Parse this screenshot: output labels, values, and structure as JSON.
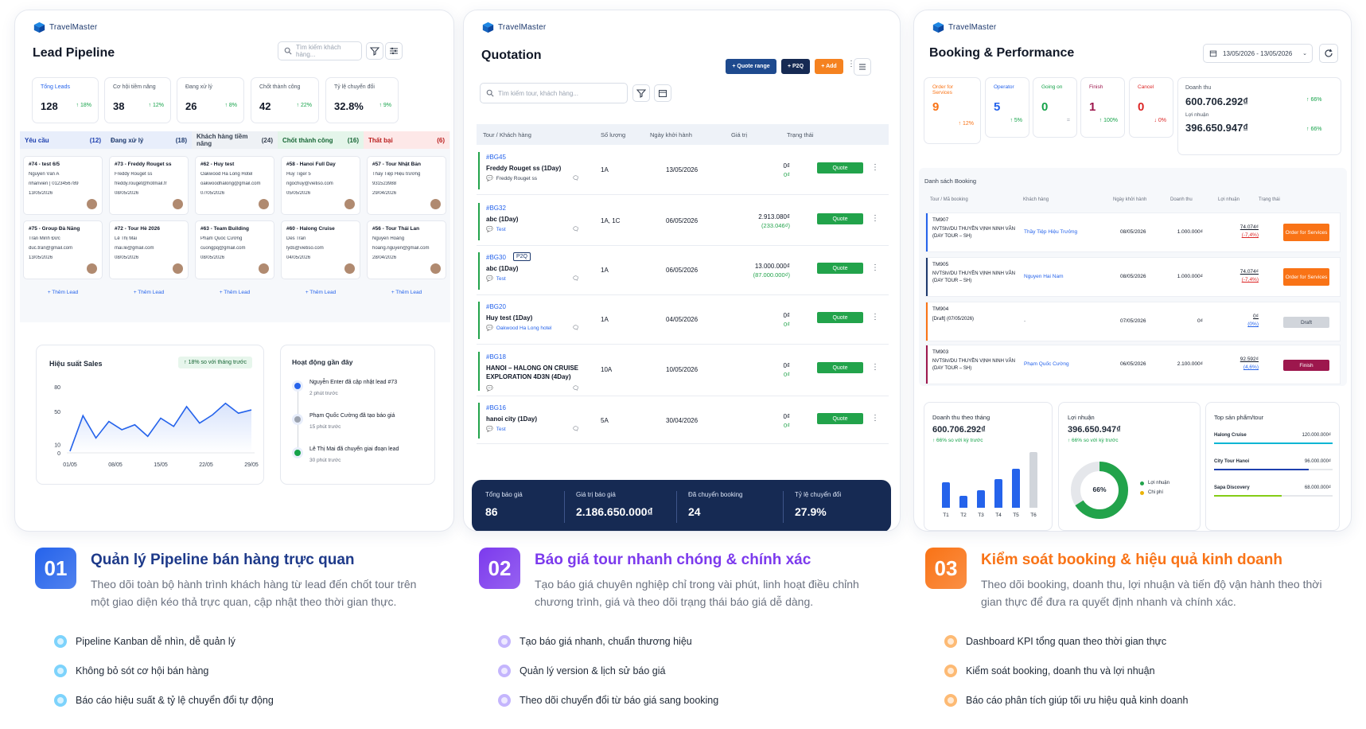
{
  "brand": "TravelMaster",
  "panel1": {
    "title": "Lead Pipeline",
    "search_placeholder": "Tìm kiếm khách hàng...",
    "kpis": [
      {
        "label": "Tổng Leads",
        "value": "128",
        "delta": "↑ 18%",
        "color": "#2563eb"
      },
      {
        "label": "Cơ hội tiềm năng",
        "value": "38",
        "delta": "↑ 12%",
        "color": "#4b5563"
      },
      {
        "label": "Đang xử lý",
        "value": "26",
        "delta": "↑ 8%",
        "color": "#4b5563"
      },
      {
        "label": "Chốt thành công",
        "value": "42",
        "delta": "↑ 22%",
        "color": "#4b5563"
      },
      {
        "label": "Tỷ lệ chuyển đổi",
        "value": "32.8%",
        "delta": "↑ 9%",
        "color": "#4b5563"
      }
    ],
    "columns": [
      {
        "name": "Yêu cầu",
        "count": "(12)",
        "bg": "#e8eefb",
        "color": "#1e40af",
        "cards": [
          {
            "title": "#74 - test 6/5",
            "l1": "Nguyễn Văn A",
            "l2": "nhanvien | 0123456789",
            "date": "13/05/2026"
          },
          {
            "title": "#75 - Group Đà Nẵng",
            "l1": "Trần Minh Đức",
            "l2": "duc.tran@gmail.com",
            "date": "13/05/2026"
          }
        ]
      },
      {
        "name": "Đang xử lý",
        "count": "(18)",
        "bg": "#e8eefb",
        "color": "#1e3a6e",
        "cards": [
          {
            "title": "#73 - Freddy Rouget ss",
            "l1": "Freddy Rouget ss",
            "l2": "freddy.rouget@hotmail.fr",
            "date": "08/05/2026"
          },
          {
            "title": "#72 - Tour Hè 2026",
            "l1": "Lê Thị Mai",
            "l2": "mai.le@gmail.com",
            "date": "08/05/2026"
          }
        ]
      },
      {
        "name": "Khách hàng tiềm năng",
        "count": "(24)",
        "bg": "#eef1f5",
        "color": "#374151",
        "cards": [
          {
            "title": "#62 - Huy test",
            "l1": "Oakwood Ha Long Hotel",
            "l2": "oakwoodhalong@gmail.com",
            "date": "07/05/2026"
          },
          {
            "title": "#63 - Team Building",
            "l1": "Phạm Quốc Cường",
            "l2": "cuongpq@gmail.com",
            "date": "08/05/2026"
          }
        ]
      },
      {
        "name": "Chốt thành công",
        "count": "(16)",
        "bg": "#e4f5ea",
        "color": "#166534",
        "cards": [
          {
            "title": "#58 - Hanoi Full Day",
            "l1": "Huy Tiger 5",
            "l2": "ngochuy@vietiso.com",
            "date": "05/05/2026"
          },
          {
            "title": "#60 - Halong Cruise",
            "l1": "Des Tran",
            "l2": "lyds@vietiso.com",
            "date": "04/05/2026"
          }
        ]
      },
      {
        "name": "Thất bại",
        "count": "(6)",
        "bg": "#fde8e8",
        "color": "#b91c1c",
        "cards": [
          {
            "title": "#57 - Tour Nhật Bản",
            "l1": "Thầy Tiệp Hiệu trưởng",
            "l2": "931523988",
            "date": "29/04/2026"
          },
          {
            "title": "#56 - Tour Thái Lan",
            "l1": "Nguyễn Hoàng",
            "l2": "hoang.nguyen@gmail.com",
            "date": "28/04/2026"
          }
        ]
      }
    ],
    "add_lead": "+ Thêm Lead",
    "sales": {
      "title": "Hiệu suất Sales",
      "badge": "↑ 18% so với tháng trước",
      "y_ticks": [
        "80",
        "50",
        "10",
        "0"
      ],
      "x_ticks": [
        "01/05",
        "08/05",
        "15/05",
        "22/05",
        "29/05"
      ]
    },
    "activity": {
      "title": "Hoạt động gần đây",
      "items": [
        {
          "text": "Nguyễn Enter đã cập nhật lead #73",
          "time": "2 phút trước",
          "color": "#2563eb"
        },
        {
          "text": "Phạm Quốc Cường đã tạo báo giá",
          "time": "15 phút trước",
          "color": "#9ca3af"
        },
        {
          "text": "Lê Thị Mai đã chuyển giai đoạn lead",
          "time": "30 phút trước",
          "color": "#16a34a"
        }
      ]
    }
  },
  "chart_data": {
    "type": "line",
    "x": [
      "01/05",
      "03/05",
      "05/05",
      "07/05",
      "09/05",
      "11/05",
      "13/05",
      "15/05",
      "17/05",
      "19/05",
      "21/05",
      "23/05",
      "25/05",
      "27/05",
      "29/05"
    ],
    "series": [
      {
        "values": [
          2,
          45,
          18,
          38,
          28,
          34,
          20,
          42,
          32,
          56,
          36,
          46,
          60,
          48,
          52
        ]
      }
    ],
    "ylim": [
      0,
      80
    ],
    "xlabel": "",
    "ylabel": ""
  },
  "panel2": {
    "title": "Quotation",
    "buttons": {
      "range": "+ Quote range",
      "p2q": "+ P2Q",
      "add": "+ Add"
    },
    "search_placeholder": "Tìm kiếm tour, khách hàng...",
    "headers": {
      "tour": "Tour / Khách hàng",
      "qty": "Số lượng",
      "date": "Ngày khởi hành",
      "value": "Giá trị",
      "status": "Trạng thái"
    },
    "rows": [
      {
        "code": "#BG45",
        "name": "Freddy Rouget ss (1Day)",
        "sub": "Freddy Rouget ss",
        "qty": "1A",
        "date": "13/05/2026",
        "v1": "0₫",
        "v2": "0₫",
        "status": "Quote",
        "tag": ""
      },
      {
        "code": "#BG32",
        "name": "abc (1Day)",
        "sub": "Test",
        "qty": "1A, 1C",
        "date": "06/05/2026",
        "v1": "2.913.080₫",
        "v2": "(233.046₫)",
        "status": "Quote",
        "tag": ""
      },
      {
        "code": "#BG30",
        "name": "abc (1Day)",
        "sub": "Test",
        "qty": "1A",
        "date": "06/05/2026",
        "v1": "13.000.000₫",
        "v2": "(87.000.000₫)",
        "status": "Quote",
        "tag": "P2Q"
      },
      {
        "code": "#BG20",
        "name": "Huy test (1Day)",
        "sub": "Oakwood Ha Long hotel",
        "qty": "1A",
        "date": "04/05/2026",
        "v1": "0₫",
        "v2": "0₫",
        "status": "Quote",
        "tag": ""
      },
      {
        "code": "#BG18",
        "name": "HANOI – HALONG ON CRUISE EXPLORATION 4D3N (4Day)",
        "sub": "",
        "qty": "10A",
        "date": "10/05/2026",
        "v1": "0₫",
        "v2": "0₫",
        "status": "Quote",
        "tag": ""
      },
      {
        "code": "#BG16",
        "name": "hanoi city (1Day)",
        "sub": "Test",
        "qty": "5A",
        "date": "30/04/2026",
        "v1": "0₫",
        "v2": "0₫",
        "status": "Quote",
        "tag": ""
      }
    ],
    "summary": [
      {
        "label": "Tổng báo giá",
        "value": "86"
      },
      {
        "label": "Giá trị báo giá",
        "value": "2.186.650.000₫"
      },
      {
        "label": "Đã chuyển booking",
        "value": "24"
      },
      {
        "label": "Tỷ lệ chuyển đổi",
        "value": "27.9%"
      }
    ]
  },
  "panel3": {
    "title": "Booking & Performance",
    "date_range": "13/05/2026 - 13/05/2026",
    "kpis": [
      {
        "label": "Order for Services",
        "value": "9",
        "delta": "↑ 12%",
        "color": "#f97316"
      },
      {
        "label": "Operator",
        "value": "5",
        "delta": "↑ 5%",
        "color": "#2563eb"
      },
      {
        "label": "Going on",
        "value": "0",
        "delta": "=",
        "color": "#16a34a"
      },
      {
        "label": "Finish",
        "value": "1",
        "delta": "↑ 100%",
        "color": "#9d174d"
      },
      {
        "label": "Cancel",
        "value": "0",
        "delta": "↓ 0%",
        "color": "#dc2626"
      }
    ],
    "revenue": {
      "label": "Doanh thu",
      "value": "600.706.292₫",
      "delta": "↑ 66%",
      "profit_label": "Lợi nhuận",
      "profit": "396.650.947₫",
      "profit_delta": "↑ 66%"
    },
    "list_title": "Danh sách Booking",
    "headers": {
      "tour": "Tour / Mã booking",
      "customer": "Khách hàng",
      "date": "Ngày khởi hành",
      "revenue": "Doanh thu",
      "profit": "Lợi nhuận",
      "status": "Trạng thái"
    },
    "rows": [
      {
        "code": "TM907",
        "name": "NVTSh//DU THUYỀN VỊNH NINH VÂN (DAY TOUR – SH)",
        "customer": "Thầy Tiệp Hiệu Trưởng",
        "date": "08/05/2026",
        "rev": "1.000.000₫",
        "profit": "74.074₫",
        "pct": "(-7,4%)",
        "status": "Order for Services",
        "scolor": "#f97316",
        "bar": "#2563eb"
      },
      {
        "code": "TM905",
        "name": "NVTSh//DU THUYỀN VỊNH NINH VÂN (DAY TOUR – SH)",
        "customer": "Nguyen Hai Nam",
        "date": "08/05/2026",
        "rev": "1.000.000₫",
        "profit": "74.074₫",
        "pct": "(-7,4%)",
        "status": "Order for Services",
        "scolor": "#f97316",
        "bar": "#1e3a6e"
      },
      {
        "code": "TM904",
        "name": "[Draft] (07/05/2026)",
        "customer": "-",
        "date": "07/05/2026",
        "rev": "0₫",
        "profit": "0₫",
        "pct": "(0%)",
        "status": "Draft",
        "scolor": "#d1d5db",
        "bar": "#f97316"
      },
      {
        "code": "TM903",
        "name": "NVTSh//DU THUYỀN VỊNH NINH VÂN (DAY TOUR – SH)",
        "customer": "Phạm Quốc Cường",
        "date": "06/05/2026",
        "rev": "2.100.000₫",
        "profit": "92.592₫",
        "pct": "(4,6%)",
        "status": "Finish",
        "scolor": "#9d174d",
        "bar": "#9d174d"
      }
    ],
    "monthly": {
      "title": "Doanh thu theo tháng",
      "value": "600.706.292₫",
      "delta": "↑ 66% so với kỳ trước",
      "months": [
        "T1",
        "T2",
        "T3",
        "T4",
        "T5",
        "T6"
      ],
      "levels": [
        0.45,
        0.22,
        0.32,
        0.52,
        0.7,
        1.0
      ]
    },
    "profit": {
      "title": "Lợi nhuận",
      "value": "396.650.947₫",
      "delta": "↑ 66% so với kỳ trước",
      "pct": "66%",
      "legend1": "Lợi nhuận",
      "legend2": "Chi phí"
    },
    "top": {
      "title": "Top sản phẩm/tour",
      "items": [
        {
          "name": "Halong Cruise",
          "value": "120.000.000₫",
          "level": 1.0,
          "color": "#06b6d4"
        },
        {
          "name": "City Tour Hanoi",
          "value": "96.000.000₫",
          "level": 0.8,
          "color": "#1e40af"
        },
        {
          "name": "Sapa Discovery",
          "value": "68.000.000₫",
          "level": 0.57,
          "color": "#84cc16"
        }
      ]
    }
  },
  "features": [
    {
      "num": "01",
      "title": "Quản lý Pipeline bán hàng trực quan",
      "desc": "Theo dõi toàn bộ hành trình khách hàng từ lead đến chốt tour trên một giao diện kéo thả trực quan, cập nhật theo thời gian thực.",
      "color": "#2563eb",
      "bullets": [
        "Pipeline Kanban dễ nhìn, dễ quản lý",
        "Không bỏ sót cơ hội bán hàng",
        "Báo cáo hiệu suất & tỷ lệ chuyển đổi tự động"
      ]
    },
    {
      "num": "02",
      "title": "Báo giá tour nhanh chóng & chính xác",
      "desc": "Tạo báo giá chuyên nghiệp chỉ trong vài phút, linh hoạt điều chỉnh chương trình, giá và theo dõi trạng thái báo giá dễ dàng.",
      "color": "#7c3aed",
      "bullets": [
        "Tạo báo giá nhanh, chuẩn thương hiệu",
        "Quản lý version & lịch sử báo giá",
        "Theo dõi chuyển đổi từ báo giá sang booking"
      ]
    },
    {
      "num": "03",
      "title": "Kiểm soát booking & hiệu quả kinh doanh",
      "desc": "Theo dõi booking, doanh thu, lợi nhuận và tiến độ vận hành theo thời gian thực để đưa ra quyết định nhanh và chính xác.",
      "color": "#f97316",
      "bullets": [
        "Dashboard KPI tổng quan theo thời gian thực",
        "Kiểm soát booking, doanh thu và lợi nhuận",
        "Báo cáo phân tích giúp tối ưu hiệu quả kinh doanh"
      ]
    }
  ]
}
